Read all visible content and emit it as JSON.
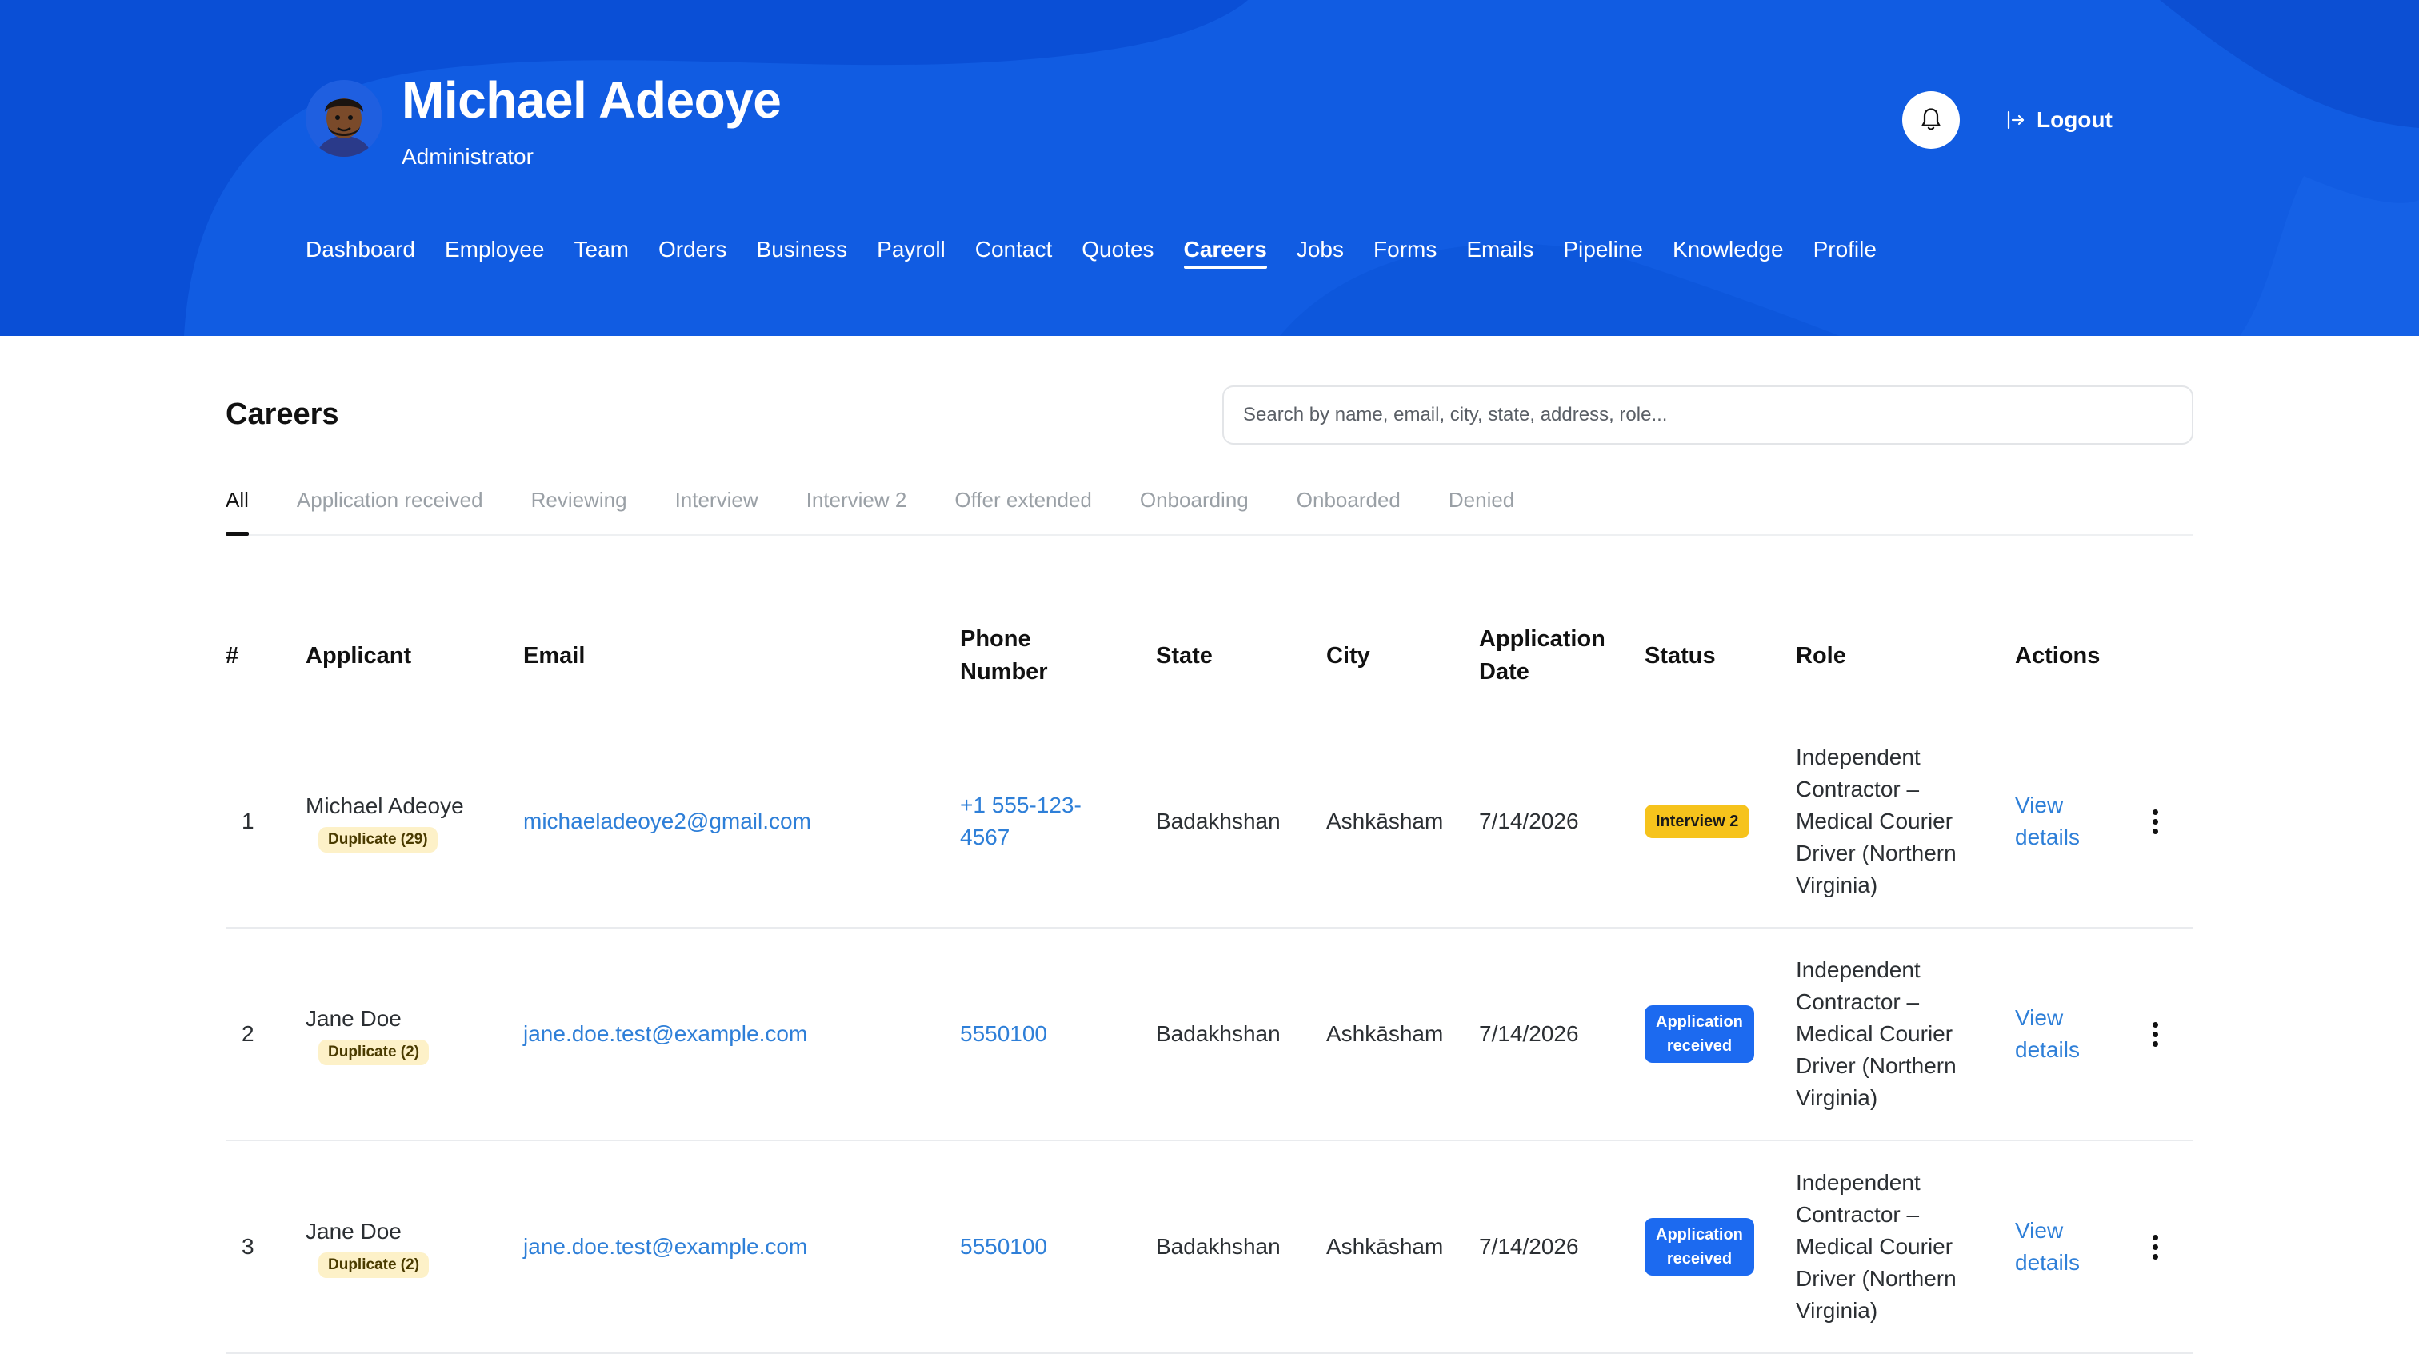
{
  "header": {
    "user_name": "Michael Adeoye",
    "user_role": "Administrator",
    "logout_label": "Logout"
  },
  "nav": {
    "items": [
      "Dashboard",
      "Employee",
      "Team",
      "Orders",
      "Business",
      "Payroll",
      "Contact",
      "Quotes",
      "Careers",
      "Jobs",
      "Forms",
      "Emails",
      "Pipeline",
      "Knowledge",
      "Profile"
    ],
    "active": "Careers"
  },
  "page": {
    "title": "Careers",
    "search_placeholder": "Search by name, email, city, state, address, role..."
  },
  "filters": {
    "items": [
      "All",
      "Application received",
      "Reviewing",
      "Interview",
      "Interview 2",
      "Offer extended",
      "Onboarding",
      "Onboarded",
      "Denied"
    ],
    "active": "All"
  },
  "table": {
    "headers": [
      "#",
      "Applicant",
      "Email",
      "Phone\nNumber",
      "State",
      "City",
      "Application\nDate",
      "Status",
      "Role",
      "Actions"
    ],
    "view_details_label": "View\ndetails",
    "rows": [
      {
        "num": "1",
        "applicant": "Michael Adeoye",
        "duplicate": "Duplicate (29)",
        "email": "michaeladeoye2@gmail.com",
        "phone": "+1 555-123-\n4567",
        "state": "Badakhshan",
        "city": "Ashkāsham",
        "date": "7/14/2026",
        "status": "Interview 2",
        "status_color": "#f6c31c",
        "role": "Independent\nContractor –\nMedical Courier\nDriver (Northern\nVirginia)"
      },
      {
        "num": "2",
        "applicant": "Jane Doe",
        "duplicate": "Duplicate (2)",
        "email": "jane.doe.test@example.com",
        "phone": "5550100",
        "state": "Badakhshan",
        "city": "Ashkāsham",
        "date": "7/14/2026",
        "status": "Application\nreceived",
        "status_color": "#1c6af0",
        "role": "Independent\nContractor –\nMedical Courier\nDriver (Northern\nVirginia)"
      },
      {
        "num": "3",
        "applicant": "Jane Doe",
        "duplicate": "Duplicate (2)",
        "email": "jane.doe.test@example.com",
        "phone": "5550100",
        "state": "Badakhshan",
        "city": "Ashkāsham",
        "date": "7/14/2026",
        "status": "Application\nreceived",
        "status_color": "#1c6af0",
        "role": "Independent\nContractor –\nMedical Courier\nDriver (Northern\nVirginia)"
      }
    ]
  },
  "colors": {
    "header_bg": "#0a4fd6",
    "link": "#2e7fd8",
    "status_yellow": "#f6c31c",
    "status_blue": "#1c6af0",
    "duplicate_bg": "#fdf1c8"
  },
  "icons": {
    "bell": "bell-icon",
    "logout": "logout-icon",
    "more": "kebab-menu-icon"
  }
}
